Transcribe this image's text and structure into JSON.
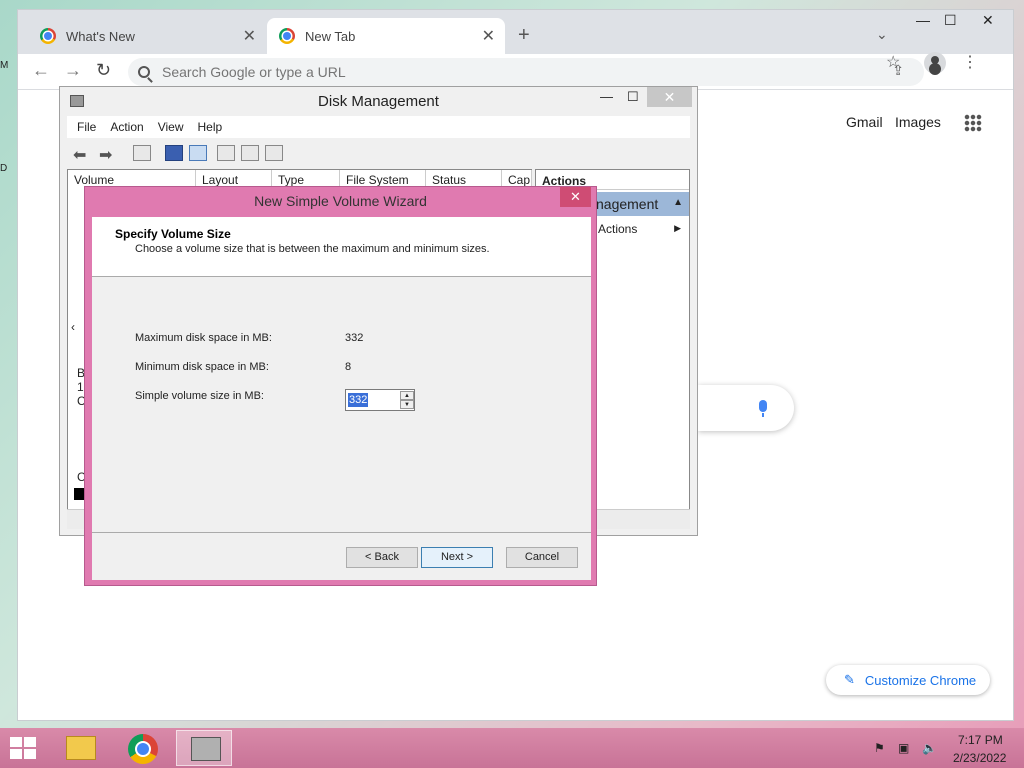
{
  "chrome": {
    "tabs": [
      {
        "label": "What's New"
      },
      {
        "label": "New Tab"
      }
    ],
    "omnibox_placeholder": "Search Google or type a URL",
    "top_links": {
      "gmail": "Gmail",
      "images": "Images"
    },
    "customize_label": "Customize Chrome"
  },
  "disk_management": {
    "title": "Disk Management",
    "menu": [
      "File",
      "Action",
      "View",
      "Help"
    ],
    "columns": [
      "Volume",
      "Layout",
      "Type",
      "File System",
      "Status",
      "Cap"
    ],
    "left_fragments": [
      "B",
      "1",
      "C",
      "C"
    ],
    "actions": {
      "header": "Actions",
      "primary": "nagement",
      "more": "Actions"
    }
  },
  "wizard": {
    "title": "New Simple Volume Wizard",
    "heading": "Specify Volume Size",
    "subheading": "Choose a volume size that is between the maximum and minimum sizes.",
    "max_label": "Maximum disk space in MB:",
    "max_value": "332",
    "min_label": "Minimum disk space in MB:",
    "min_value": "8",
    "size_label": "Simple volume size in MB:",
    "size_value": "332",
    "buttons": {
      "back": "< Back",
      "next": "Next >",
      "cancel": "Cancel"
    }
  },
  "taskbar": {
    "time": "7:17 PM",
    "date": "2/23/2022"
  },
  "colors": {
    "wizard_frame": "#e07ab0",
    "taskbar": "#d98aa9",
    "accent_blue": "#1a73e8",
    "selection": "#3a6fd8"
  }
}
